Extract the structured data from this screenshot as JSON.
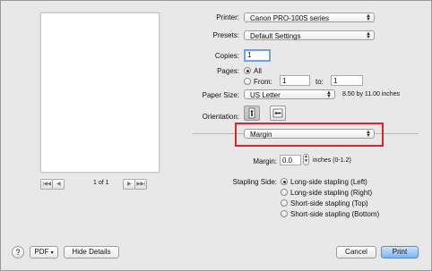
{
  "printer": {
    "label": "Printer:",
    "value": "Canon PRO-100S series"
  },
  "presets": {
    "label": "Presets:",
    "value": "Default Settings"
  },
  "copies": {
    "label": "Copies:",
    "value": "1"
  },
  "pages": {
    "label": "Pages:",
    "all_label": "All",
    "from_label": "From:",
    "from_value": "1",
    "to_label": "to:",
    "to_value": "1"
  },
  "paper_size": {
    "label": "Paper Size:",
    "value": "US Letter",
    "dimensions": "8.50 by 11.00 inches"
  },
  "orientation": {
    "label": "Orientation:",
    "portrait_icon": "portrait-icon",
    "landscape_icon": "landscape-icon"
  },
  "section_popup": {
    "value": "Margin"
  },
  "margin": {
    "label": "Margin:",
    "value": "0.0",
    "unit": "inches (0-1.2)"
  },
  "stapling": {
    "label": "Stapling Side:",
    "options": [
      "Long-side stapling (Left)",
      "Long-side stapling (Right)",
      "Short-side stapling (Top)",
      "Short-side stapling (Bottom)"
    ],
    "selected": "Long-side stapling (Left)"
  },
  "preview": {
    "page_text": "1 of 1",
    "first_icon": "first-page-icon",
    "prev_icon": "previous-page-icon",
    "next_icon": "next-page-icon",
    "last_icon": "last-page-icon"
  },
  "footer": {
    "help_label": "?",
    "pdf_label": "PDF",
    "hide_details_label": "Hide Details",
    "cancel_label": "Cancel",
    "print_label": "Print"
  },
  "colors": {
    "highlight": "#d9262c",
    "primary_button": "#7ab4f1",
    "focus_ring": "#6da4e8"
  }
}
